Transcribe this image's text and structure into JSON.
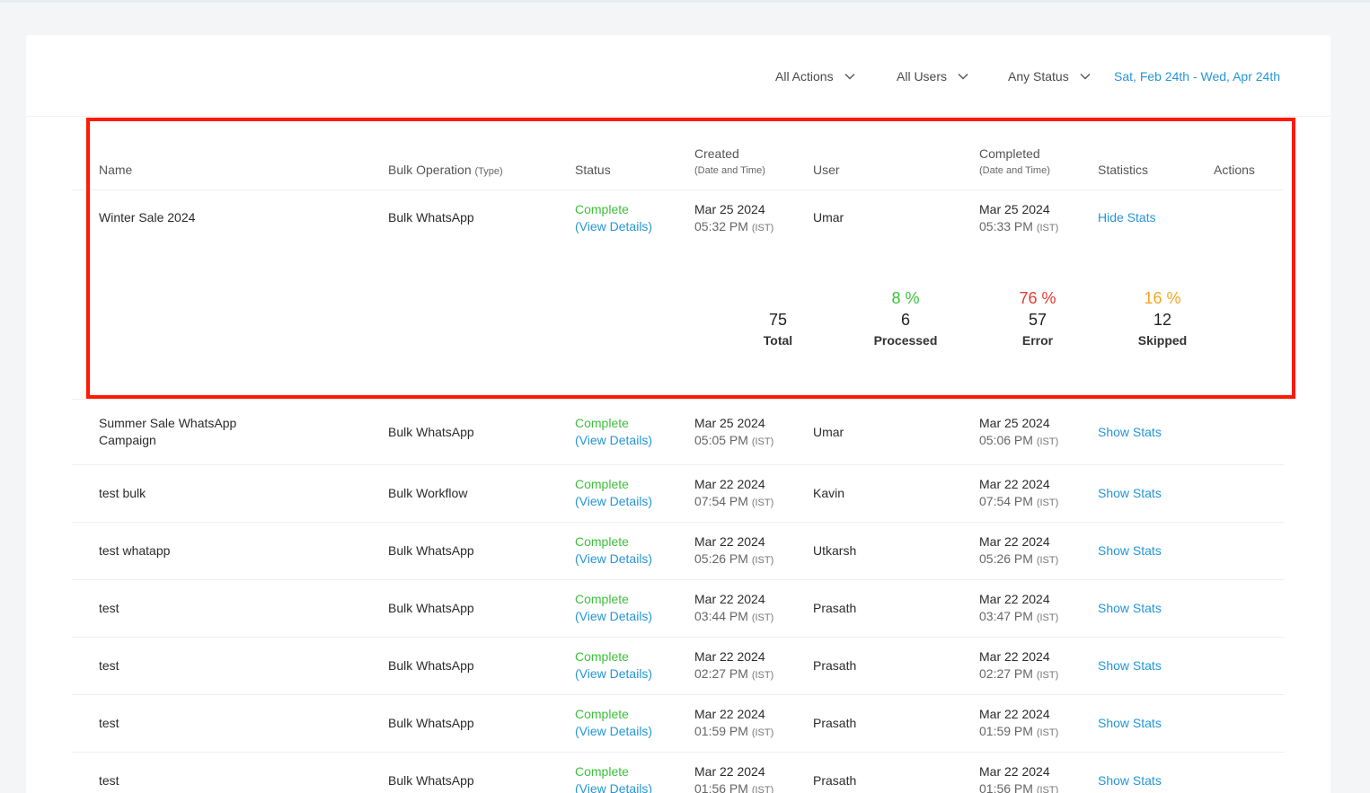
{
  "filters": {
    "actions": "All Actions",
    "users": "All Users",
    "status": "Any Status",
    "date_range": "Sat, Feb 24th - Wed, Apr 24th"
  },
  "table": {
    "headers": {
      "name": "Name",
      "operation": "Bulk Operation",
      "operation_sub": "(Type)",
      "status": "Status",
      "created": "Created",
      "created_sub": "(Date and Time)",
      "user": "User",
      "completed": "Completed",
      "completed_sub": "(Date and Time)",
      "statistics": "Statistics",
      "actions": "Actions"
    },
    "tz": "(IST)",
    "view_details": "(View Details)",
    "rows": [
      {
        "name": "Winter Sale 2024",
        "type": "Bulk WhatsApp",
        "status": "Complete",
        "created_date": "Mar 25 2024",
        "created_time": "05:32 PM",
        "user": "Umar",
        "completed_date": "Mar 25 2024",
        "completed_time": "05:33 PM",
        "stats_link": "Hide Stats"
      },
      {
        "name": "Summer Sale WhatsApp Campaign",
        "type": "Bulk WhatsApp",
        "status": "Complete",
        "created_date": "Mar 25 2024",
        "created_time": "05:05 PM",
        "user": "Umar",
        "completed_date": "Mar 25 2024",
        "completed_time": "05:06 PM",
        "stats_link": "Show Stats"
      },
      {
        "name": "test bulk",
        "type": "Bulk Workflow",
        "status": "Complete",
        "created_date": "Mar 22 2024",
        "created_time": "07:54 PM",
        "user": "Kavin",
        "completed_date": "Mar 22 2024",
        "completed_time": "07:54 PM",
        "stats_link": "Show Stats"
      },
      {
        "name": "test whatapp",
        "type": "Bulk WhatsApp",
        "status": "Complete",
        "created_date": "Mar 22 2024",
        "created_time": "05:26 PM",
        "user": "Utkarsh",
        "completed_date": "Mar 22 2024",
        "completed_time": "05:26 PM",
        "stats_link": "Show Stats"
      },
      {
        "name": "test",
        "type": "Bulk WhatsApp",
        "status": "Complete",
        "created_date": "Mar 22 2024",
        "created_time": "03:44 PM",
        "user": "Prasath",
        "completed_date": "Mar 22 2024",
        "completed_time": "03:47 PM",
        "stats_link": "Show Stats"
      },
      {
        "name": "test",
        "type": "Bulk WhatsApp",
        "status": "Complete",
        "created_date": "Mar 22 2024",
        "created_time": "02:27 PM",
        "user": "Prasath",
        "completed_date": "Mar 22 2024",
        "completed_time": "02:27 PM",
        "stats_link": "Show Stats"
      },
      {
        "name": "test",
        "type": "Bulk WhatsApp",
        "status": "Complete",
        "created_date": "Mar 22 2024",
        "created_time": "01:59 PM",
        "user": "Prasath",
        "completed_date": "Mar 22 2024",
        "completed_time": "01:59 PM",
        "stats_link": "Show Stats"
      },
      {
        "name": "test",
        "type": "Bulk WhatsApp",
        "status": "Complete",
        "created_date": "Mar 22 2024",
        "created_time": "01:56 PM",
        "user": "Prasath",
        "completed_date": "Mar 22 2024",
        "completed_time": "01:56 PM",
        "stats_link": "Show Stats"
      }
    ]
  },
  "expanded_stats": {
    "total": {
      "value": "75",
      "label": "Total"
    },
    "processed": {
      "pct": "8 %",
      "value": "6",
      "label": "Processed",
      "color": "#3cc13b"
    },
    "error": {
      "pct": "76 %",
      "value": "57",
      "label": "Error",
      "color": "#e53935"
    },
    "skipped": {
      "pct": "16 %",
      "value": "12",
      "label": "Skipped",
      "color": "#f5a623"
    }
  },
  "colors": {
    "accent": "#2596d8",
    "highlight": "#ff1a00"
  }
}
